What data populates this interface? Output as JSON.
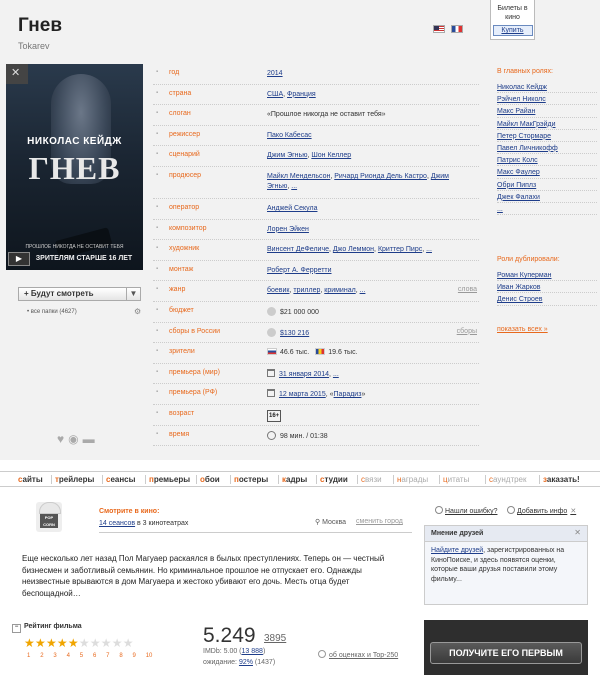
{
  "movie": {
    "title": "Гнев",
    "original_title": "Tokarev"
  },
  "tickets": {
    "label": "Билеты в кино",
    "buy": "Купить"
  },
  "poster": {
    "actor": "НИКОЛАС КЕЙДЖ",
    "title": "ГНЕВ",
    "tagline": "ПРОШЛОЕ НИКОГДА НЕ ОСТАВИТ ТЕБЯ",
    "age_text": "ЗРИТЕЛЯМ СТАРШЕ 16 ЛЕТ",
    "play": "▶"
  },
  "watchlist": {
    "button": "+ Будут смотреть",
    "arrow": "▼",
    "folders": "• все папки (4627)"
  },
  "info": {
    "year": {
      "label": "год",
      "value": "2014"
    },
    "country": {
      "label": "страна",
      "value1": "США",
      "sep": ", ",
      "value2": "Франция"
    },
    "slogan": {
      "label": "слоган",
      "value": "«Прошлое никогда не оставит тебя»"
    },
    "director": {
      "label": "режиссер",
      "value": "Пако Кабесас"
    },
    "writer": {
      "label": "сценарий",
      "value1": "Джим Эгнью",
      "sep": ", ",
      "value2": "Шон Келлер"
    },
    "producer": {
      "label": "продюсер",
      "value1": "Майкл Мендельсон",
      "value2": "Ричард Риондa Дель Кастро",
      "value3": "Джим Эгнью",
      "more": "..."
    },
    "operator": {
      "label": "оператор",
      "value": "Анджей Секула"
    },
    "composer": {
      "label": "композитор",
      "value": "Лорен Эйкен"
    },
    "artist": {
      "label": "художник",
      "value1": "Винсент ДеФеличе",
      "value2": "Джо Леммон",
      "value3": "Криттер Пирс",
      "more": "..."
    },
    "editing": {
      "label": "монтаж",
      "value": "Роберт А. Ферретти"
    },
    "genre": {
      "label": "жанр",
      "value1": "боевик",
      "value2": "триллер",
      "value3": "криминал",
      "more": "...",
      "side": "слова"
    },
    "budget": {
      "label": "бюджет",
      "value": "$21 000 000"
    },
    "box_russia": {
      "label": "сборы в России",
      "value": "$130 216",
      "side": "сборы"
    },
    "viewers": {
      "label": "зрители",
      "value1": "46.6 тыс.",
      "value2": "19.6 тыс."
    },
    "premiere_world": {
      "label": "премьера (мир)",
      "value": "31 января 2014",
      "more": "..."
    },
    "premiere_rf": {
      "label": "премьера (РФ)",
      "value": "12 марта 2015",
      "extra_pre": ", «",
      "extra": "Парадиз",
      "extra_post": "»"
    },
    "age": {
      "label": "возраст",
      "value": "16+"
    },
    "time": {
      "label": "время",
      "value": "98 мин. / 01:38"
    }
  },
  "cast": {
    "heading": "В главных ролях:",
    "actors": [
      "Николас Кейдж",
      "Рэйчел Николс",
      "Макс Райан",
      "Майкл МакГрэйди",
      "Петер Стормаре",
      "Павел Личникофф",
      "Патрис Колс",
      "Макс Фаулер",
      "Обри Пиплз",
      "Джек Фалахи",
      "..."
    ],
    "dub_heading": "Роли дублировали:",
    "dubbers": [
      "Роман Куперман",
      "Иван Жарков",
      "Денис Строев"
    ],
    "show_all": "показать всех »"
  },
  "nav": [
    "сайты",
    "трейлеры",
    "сеансы",
    "премьеры",
    "обои",
    "постеры",
    "кадры",
    "студии",
    "связи",
    "награды",
    "цитаты",
    "саундтрек",
    "заказать!"
  ],
  "cinema": {
    "popcorn": "POP CORN",
    "title": "Смотрите в кино:",
    "sessions": "14 сеансов",
    "sessions_suffix": " в 3 кинотеатрах",
    "city": "Москва",
    "change_city": "сменить город",
    "error_link": "Нашли ошибку?",
    "add_info": "Добавить инфо"
  },
  "synopsis": "Еще несколько лет назад Пол Магуаер раскаялся в былых преступлениях. Теперь он — честный бизнесмен и заботливый семьянин. Но криминальное прошлое не отпускает его. Однажды неизвестные врываются в дом Магуаера и жестоко убивают его дочь. Месть отца будет беспощадной…",
  "friends": {
    "title": "Мнение друзей",
    "link": "Найдите друзей",
    "text": ", зарегистрированных на КиноПоиске, и здесь появятся оценки, которые ваши друзья поставили этому фильму..."
  },
  "rating": {
    "heading": "Рейтинг фильма",
    "value": "5.249",
    "votes": "3895",
    "star_fraction": 0.52,
    "star_labels": [
      "1",
      "2",
      "3",
      "4",
      "5",
      "6",
      "7",
      "8",
      "9",
      "10"
    ],
    "imdb_pre": "IMDb: 5.00 (",
    "imdb_votes": "13 888",
    "imdb_post": ")",
    "expect_pre": "ожидание: ",
    "expect_pct": "92%",
    "expect_post": " (1437)",
    "about": "об оценках и Top-250"
  },
  "banner": {
    "button": "ПОЛУЧИТЕ ЕГО ПЕРВЫМ"
  },
  "colors": {
    "accent": "#e8691d",
    "link": "#1e3d8a",
    "star": "#f0a500"
  }
}
